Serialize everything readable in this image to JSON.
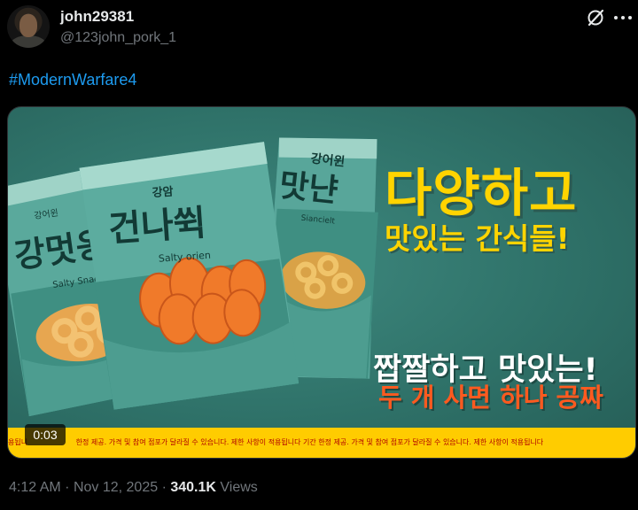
{
  "post": {
    "author": {
      "display_name": "john29381",
      "handle": "@123john_pork_1"
    },
    "hashtag": "#ModernWarfare4",
    "media": {
      "headline_line1": "다양하고",
      "headline_line2": "맛있는 간식들!",
      "promo_line1": "짭짤하고 맛있는!",
      "promo_line2": "두 개 사면 하나 공짜",
      "ticker_text": "한정 제공. 가격 및 참여 점포가 달라질 수 있습니다. 제한 사항이 적용됩니다 기간 한정 제공. 가격 및 참여 점포가 달라질 수 있습니다. 제한 사항이 적용됩니다",
      "ticker_prefix": "용됩니",
      "video_time": "0:03",
      "bags": {
        "left": {
          "brand": "강어윈",
          "name": "강멋옹",
          "sub": "Salty Snack"
        },
        "center": {
          "brand": "강암",
          "name": "건나쒹",
          "sub": "Salty orien"
        },
        "right": {
          "brand": "강어윈",
          "name": "맛냔",
          "sub": "Siancielt"
        }
      }
    },
    "meta": {
      "time": "4:12 AM",
      "date": "Nov 12, 2025",
      "views_count": "340.1K",
      "views_label": "Views",
      "separator": "·"
    },
    "icons": [
      "grok-icon",
      "more-options-icon"
    ],
    "colors": {
      "background": "#000000",
      "link": "#1d9bf0",
      "muted": "#71767b",
      "text": "#e7e9ea",
      "media_bg": "#2f7269",
      "headline": "#ffd400",
      "promo_accent": "#ff5a1f",
      "ticker_bg": "#ffcc00"
    }
  }
}
